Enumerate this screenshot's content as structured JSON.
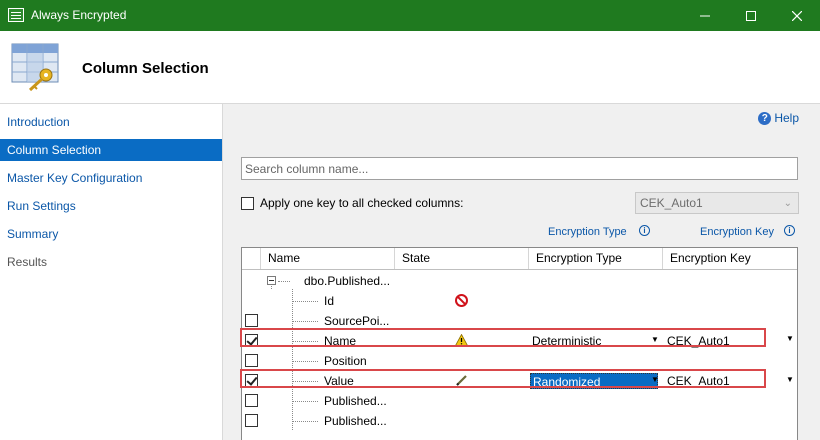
{
  "window": {
    "title": "Always Encrypted"
  },
  "header": {
    "title": "Column Selection"
  },
  "nav": {
    "items": [
      {
        "label": "Introduction",
        "selected": false,
        "enabled": true
      },
      {
        "label": "Column Selection",
        "selected": true,
        "enabled": true
      },
      {
        "label": "Master Key Configuration",
        "selected": false,
        "enabled": true
      },
      {
        "label": "Run Settings",
        "selected": false,
        "enabled": true
      },
      {
        "label": "Summary",
        "selected": false,
        "enabled": true
      },
      {
        "label": "Results",
        "selected": false,
        "enabled": false
      }
    ]
  },
  "help": {
    "label": "Help"
  },
  "search": {
    "placeholder": "Search column name..."
  },
  "apply": {
    "label": "Apply one key to all checked columns:",
    "checked": false,
    "key_value": "CEK_Auto1"
  },
  "labels": {
    "encryption_type": "Encryption Type",
    "encryption_key": "Encryption Key"
  },
  "grid": {
    "columns": [
      "Name",
      "State",
      "Encryption Type",
      "Encryption Key"
    ],
    "table_name": "dbo.Published...",
    "rows": [
      {
        "name": "Id",
        "checkbox": false,
        "checked": false,
        "state": "blocked-icon",
        "encryption_type": "",
        "encryption_key": ""
      },
      {
        "name": "SourcePoi...",
        "checkbox": true,
        "checked": false,
        "state": "",
        "encryption_type": "",
        "encryption_key": ""
      },
      {
        "name": "Name",
        "checkbox": true,
        "checked": true,
        "state": "warning-icon",
        "encryption_type": "Deterministic",
        "encryption_key": "CEK_Auto1"
      },
      {
        "name": "Position",
        "checkbox": true,
        "checked": false,
        "state": "",
        "encryption_type": "",
        "encryption_key": ""
      },
      {
        "name": "Value",
        "checkbox": true,
        "checked": true,
        "state": "pencil-icon",
        "encryption_type": "Randomized",
        "encryption_key": "CEK_Auto1"
      },
      {
        "name": "Published...",
        "checkbox": true,
        "checked": false,
        "state": "",
        "encryption_type": "",
        "encryption_key": ""
      },
      {
        "name": "Published...",
        "checkbox": true,
        "checked": false,
        "state": "",
        "encryption_type": "",
        "encryption_key": ""
      }
    ]
  },
  "colors": {
    "titlebar": "#1f7a1f",
    "nav_selected": "#0a6cc4",
    "link": "#0b57a8",
    "highlight": "#d9474a"
  }
}
